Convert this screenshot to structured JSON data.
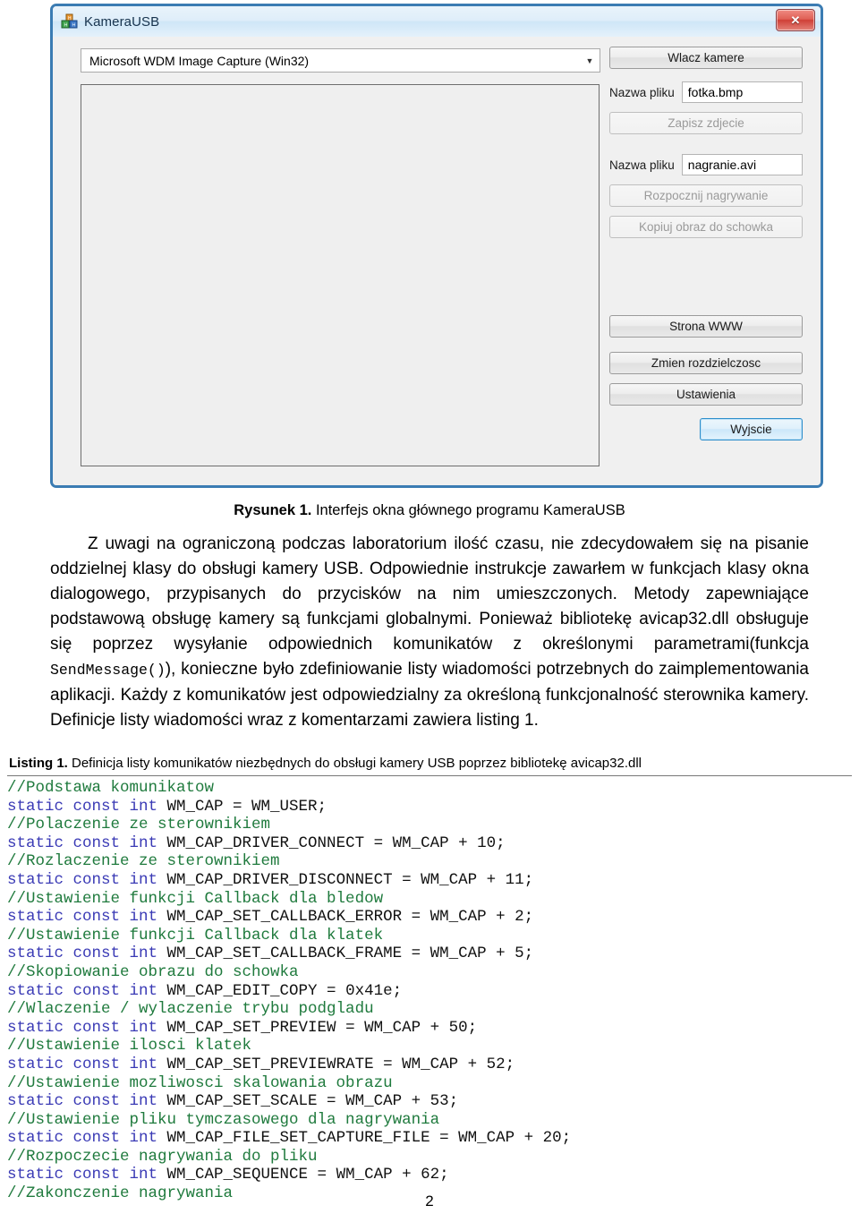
{
  "window": {
    "title": "KameraUSB",
    "icon": "camera-grid-icon",
    "close_label": "✕",
    "device_combo": {
      "value": "Microsoft WDM Image Capture (Win32)",
      "arrow": "▼"
    },
    "preview_area": "",
    "buttons": {
      "start_camera": "Wlacz kamere",
      "save_photo": "Zapisz zdjecie",
      "start_recording": "Rozpocznij nagrywanie",
      "copy_to_clipboard": "Kopiuj obraz do schowka",
      "www_page": "Strona WWW",
      "change_resolution": "Zmien rozdzielczosc",
      "settings": "Ustawienia",
      "exit": "Wyjscie"
    },
    "fields": {
      "photo_label": "Nazwa pliku",
      "photo_value": "fotka.bmp",
      "video_label": "Nazwa pliku",
      "video_value": "nagranie.avi"
    }
  },
  "document": {
    "figure_caption_prefix": "Rysunek 1.",
    "figure_caption_text": " Interfejs okna głównego programu KameraUSB",
    "paragraph_part1": "Z uwagi na ograniczoną podczas laboratorium ilość czasu, nie zdecydowałem się na pisanie oddzielnej klasy do obsługi kamery USB. Odpowiednie instrukcje zawarłem w funkcjach klasy okna dialogowego, przypisanych do przycisków na nim umieszczonych. Metody zapewniające podstawową obsługę kamery są funkcjami globalnymi. Ponieważ bibliotekę avicap32.dll obsługuje się poprzez wysyłanie odpowiednich komunikatów z określonymi parametrami(funkcja ",
    "paragraph_mono": "SendMessage()",
    "paragraph_part2": "), konieczne było zdefiniowanie listy wiadomości potrzebnych do zaimplementowania aplikacji. Każdy z komunikatów jest odpowiedzialny za określoną funkcjonalność sterownika kamery. Definicje listy wiadomości wraz z komentarzami zawiera listing 1.",
    "listing_label": "Listing 1.",
    "listing_text": " Definicja listy komunikatów niezbędnych do obsługi kamery USB poprzez bibliotekę avicap32.dll",
    "page_number": "2"
  },
  "code_lines": [
    {
      "type": "comment",
      "text": "//Podstawa komunikatow"
    },
    {
      "type": "code",
      "kw": "static const int",
      "rest": " WM_CAP = WM_USER;"
    },
    {
      "type": "comment",
      "text": "//Polaczenie ze sterownikiem"
    },
    {
      "type": "code",
      "kw": "static const int",
      "rest": " WM_CAP_DRIVER_CONNECT = WM_CAP + 10;"
    },
    {
      "type": "comment",
      "text": "//Rozlaczenie ze sterownikiem"
    },
    {
      "type": "code",
      "kw": "static const int",
      "rest": " WM_CAP_DRIVER_DISCONNECT = WM_CAP + 11;"
    },
    {
      "type": "comment",
      "text": "//Ustawienie funkcji Callback dla bledow"
    },
    {
      "type": "code",
      "kw": "static const int",
      "rest": " WM_CAP_SET_CALLBACK_ERROR = WM_CAP + 2;"
    },
    {
      "type": "comment",
      "text": "//Ustawienie funkcji Callback dla klatek"
    },
    {
      "type": "code",
      "kw": "static const int",
      "rest": " WM_CAP_SET_CALLBACK_FRAME = WM_CAP + 5;"
    },
    {
      "type": "comment",
      "text": "//Skopiowanie obrazu do schowka"
    },
    {
      "type": "code",
      "kw": "static const int",
      "rest": " WM_CAP_EDIT_COPY = 0x41e;"
    },
    {
      "type": "comment",
      "text": "//Wlaczenie / wylaczenie trybu podgladu"
    },
    {
      "type": "code",
      "kw": "static const int",
      "rest": " WM_CAP_SET_PREVIEW = WM_CAP + 50;"
    },
    {
      "type": "comment",
      "text": "//Ustawienie ilosci klatek"
    },
    {
      "type": "code",
      "kw": "static const int",
      "rest": " WM_CAP_SET_PREVIEWRATE = WM_CAP + 52;"
    },
    {
      "type": "comment",
      "text": "//Ustawienie mozliwosci skalowania obrazu"
    },
    {
      "type": "code",
      "kw": "static const int",
      "rest": " WM_CAP_SET_SCALE = WM_CAP + 53;"
    },
    {
      "type": "comment",
      "text": "//Ustawienie pliku tymczasowego dla nagrywania"
    },
    {
      "type": "code",
      "kw": "static const int",
      "rest": " WM_CAP_FILE_SET_CAPTURE_FILE = WM_CAP + 20;"
    },
    {
      "type": "comment",
      "text": "//Rozpoczecie nagrywania do pliku"
    },
    {
      "type": "code",
      "kw": "static const int",
      "rest": " WM_CAP_SEQUENCE = WM_CAP + 62;"
    },
    {
      "type": "comment",
      "text": "//Zakonczenie nagrywania"
    }
  ],
  "colors": {
    "comment": "#1f7a3d",
    "keyword": "#3a3ab5",
    "window_border": "#3b7cb3",
    "close_button": "#cf3f36"
  }
}
